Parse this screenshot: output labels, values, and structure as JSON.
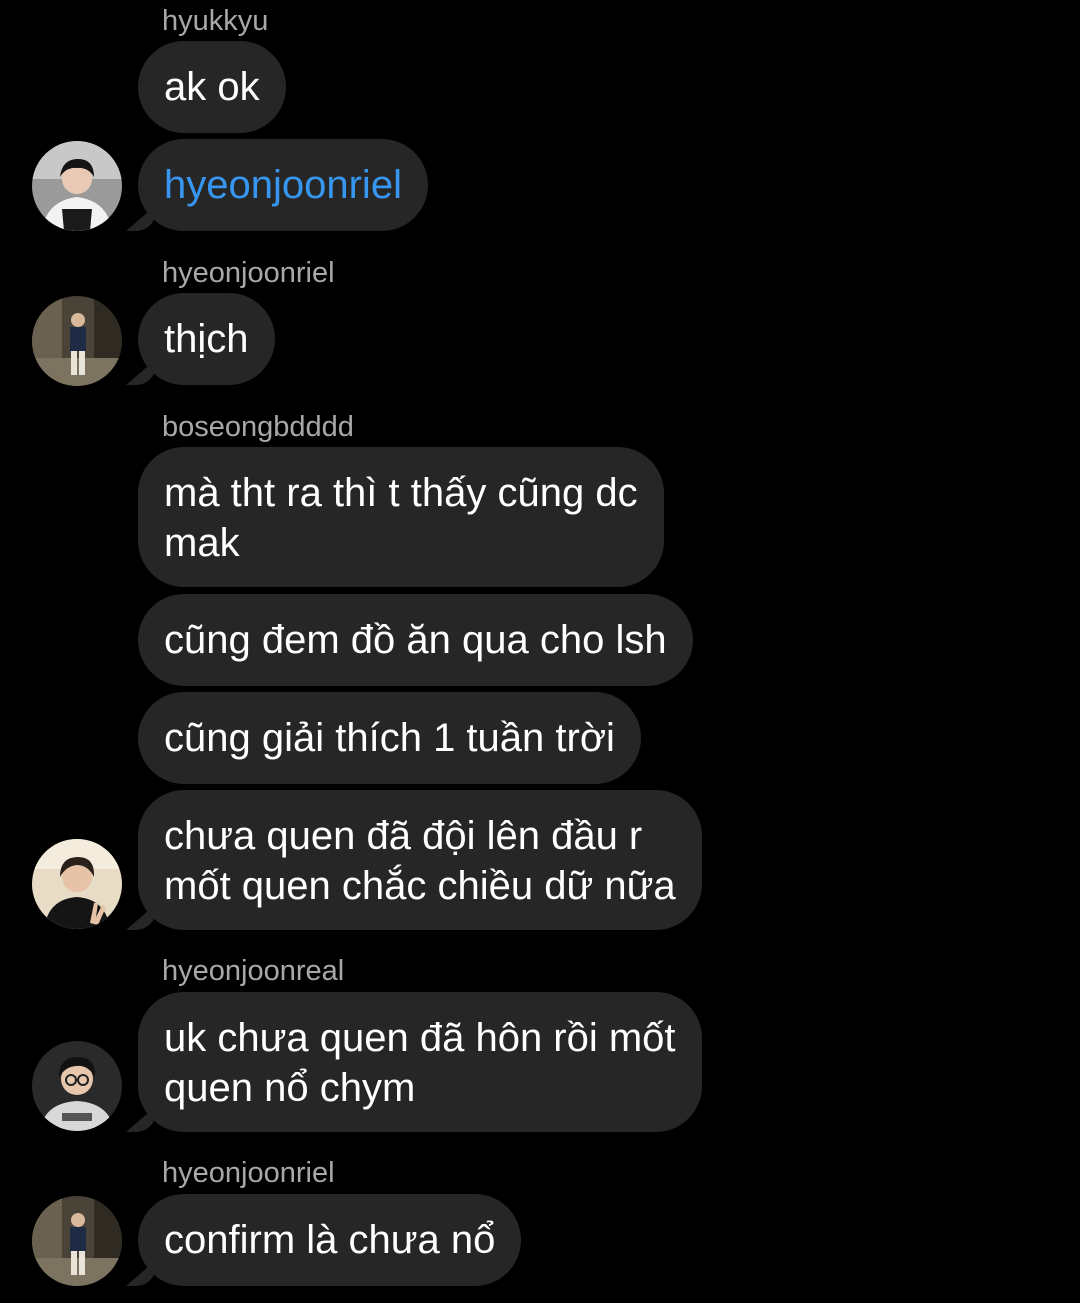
{
  "messages": [
    {
      "sender": "hyukkyu",
      "text": "ak ok"
    },
    {
      "text": "hyeonjoonriel",
      "mention": true,
      "avatar": "player-jersey-avatar"
    },
    {
      "sender": "hyeonjoonriel",
      "text": "thịch",
      "avatar": "street-photo-avatar"
    },
    {
      "sender": "boseongbdddd",
      "lines": [
        "mà tht ra thì t thấy cũng dc",
        "mak"
      ]
    },
    {
      "text": "cũng đem đồ ăn qua cho lsh"
    },
    {
      "text": "cũng giải thích 1 tuần trời"
    },
    {
      "lines": [
        "chưa quen đã đội lên đầu r",
        "mốt quen chắc chiều dữ nữa"
      ],
      "avatar": "peace-sign-avatar"
    },
    {
      "sender": "hyeonjoonreal",
      "lines": [
        "uk chưa quen đã hôn rồi mốt",
        "quen nổ chym"
      ],
      "avatar": "glasses-avatar"
    },
    {
      "sender": "hyeonjoonriel",
      "text": "confirm là chưa nổ",
      "avatar": "street-photo-avatar"
    }
  ],
  "colors": {
    "background": "#000000",
    "bubble": "#262626",
    "text": "#ffffff",
    "sender": "#a8a8a8",
    "mention": "#3797f0"
  }
}
